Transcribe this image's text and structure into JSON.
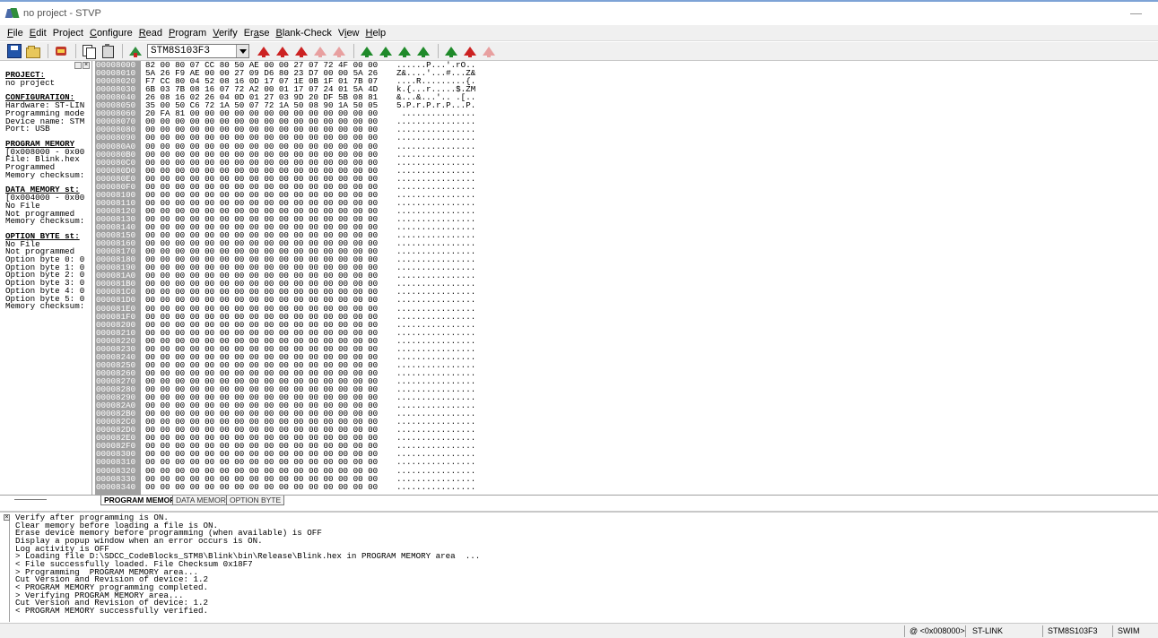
{
  "window": {
    "title": "no project - STVP",
    "min_glyph": "—"
  },
  "menu": [
    {
      "label": "File",
      "ul": "F",
      "rest": "ile"
    },
    {
      "label": "Edit",
      "ul": "E",
      "rest": "dit"
    },
    {
      "label": "Project",
      "ul": "j",
      "pre": "Pro",
      "rest": "ect"
    },
    {
      "label": "Configure",
      "ul": "C",
      "rest": "onfigure"
    },
    {
      "label": "Read",
      "ul": "R",
      "rest": "ead"
    },
    {
      "label": "Program",
      "ul": "P",
      "rest": "rogram"
    },
    {
      "label": "Verify",
      "ul": "V",
      "rest": "erify"
    },
    {
      "label": "Erase",
      "ul": "a",
      "pre": "Er",
      "rest": "se"
    },
    {
      "label": "Blank-Check",
      "ul": "B",
      "rest": "lank-Check"
    },
    {
      "label": "View",
      "ul": "i",
      "pre": "V",
      "rest": "ew"
    },
    {
      "label": "Help",
      "ul": "H",
      "rest": "elp"
    }
  ],
  "toolbar": {
    "device": "STM8S103F3",
    "arrow_colors": [
      "#cc2222",
      "#cc2222",
      "#cc2222",
      "#e8a0a0",
      "#e8a0a0",
      "#1f8a2a",
      "#1f8a2a",
      "#1f8a2a",
      "#1f8a2a",
      "#1f8a2a",
      "#cc2222",
      "#e8a0a0"
    ]
  },
  "info_panel": {
    "project_header": "PROJECT:",
    "project_lines": [
      "no project"
    ],
    "config_header": "CONFIGURATION:",
    "config_lines": [
      "Hardware: ST-LIN",
      "Programming mode",
      "Device name: STM",
      "Port: USB"
    ],
    "prog_header": "PROGRAM MEMORY",
    "prog_lines": [
      "[0x008000 - 0x00",
      "File: Blink.hex",
      "Programmed",
      "Memory checksum:"
    ],
    "data_header": "DATA MEMORY st:",
    "data_lines": [
      "[0x004000 - 0x00",
      "No File",
      "Not programmed",
      "Memory checksum:"
    ],
    "opt_header": "OPTION BYTE st:",
    "opt_lines": [
      "No File",
      "Not programmed",
      "Option byte 0: 0",
      "Option byte 1: 0",
      "Option byte 2: 0",
      "Option byte 3: 0",
      "Option byte 4: 0",
      "Option byte 5: 0",
      "Memory checksum:"
    ]
  },
  "hex": {
    "rows": [
      {
        "addr": "00008000",
        "bytes": "82 00 80 07 CC 80 50 AE 00 00 27 07 72 4F 00 00",
        "ascii": "......P...'.rO.."
      },
      {
        "addr": "00008010",
        "bytes": "5A 26 F9 AE 00 00 27 09 D6 80 23 D7 00 00 5A 26",
        "ascii": "Z&....'...#...Z&"
      },
      {
        "addr": "00008020",
        "bytes": "F7 CC 80 04 52 08 16 0D 17 07 1E 0B 1F 01 7B 07",
        "ascii": "....R.........{."
      },
      {
        "addr": "00008030",
        "bytes": "6B 03 7B 08 16 07 72 A2 00 01 17 07 24 01 5A 4D",
        "ascii": "k.{...r.....$.ZM"
      },
      {
        "addr": "00008040",
        "bytes": "26 08 16 02 26 04 0D 01 27 03 9D 20 DF 5B 08 81",
        "ascii": "&...&...'.. .[.."
      },
      {
        "addr": "00008050",
        "bytes": "35 00 50 C6 72 1A 50 07 72 1A 50 08 90 1A 50 05",
        "ascii": "5.P.r.P.r.P...P."
      },
      {
        "addr": "00008060",
        "bytes": "20 FA 81 00 00 00 00 00 00 00 00 00 00 00 00 00",
        "ascii": " ..............."
      },
      {
        "addr": "00008070",
        "bytes": "00 00 00 00 00 00 00 00 00 00 00 00 00 00 00 00",
        "ascii": "................"
      },
      {
        "addr": "00008080",
        "bytes": "00 00 00 00 00 00 00 00 00 00 00 00 00 00 00 00",
        "ascii": "................"
      },
      {
        "addr": "00008090",
        "bytes": "00 00 00 00 00 00 00 00 00 00 00 00 00 00 00 00",
        "ascii": "................"
      },
      {
        "addr": "000080A0",
        "bytes": "00 00 00 00 00 00 00 00 00 00 00 00 00 00 00 00",
        "ascii": "................"
      },
      {
        "addr": "000080B0",
        "bytes": "00 00 00 00 00 00 00 00 00 00 00 00 00 00 00 00",
        "ascii": "................"
      },
      {
        "addr": "000080C0",
        "bytes": "00 00 00 00 00 00 00 00 00 00 00 00 00 00 00 00",
        "ascii": "................"
      },
      {
        "addr": "000080D0",
        "bytes": "00 00 00 00 00 00 00 00 00 00 00 00 00 00 00 00",
        "ascii": "................"
      },
      {
        "addr": "000080E0",
        "bytes": "00 00 00 00 00 00 00 00 00 00 00 00 00 00 00 00",
        "ascii": "................"
      },
      {
        "addr": "000080F0",
        "bytes": "00 00 00 00 00 00 00 00 00 00 00 00 00 00 00 00",
        "ascii": "................"
      },
      {
        "addr": "00008100",
        "bytes": "00 00 00 00 00 00 00 00 00 00 00 00 00 00 00 00",
        "ascii": "................"
      },
      {
        "addr": "00008110",
        "bytes": "00 00 00 00 00 00 00 00 00 00 00 00 00 00 00 00",
        "ascii": "................"
      },
      {
        "addr": "00008120",
        "bytes": "00 00 00 00 00 00 00 00 00 00 00 00 00 00 00 00",
        "ascii": "................"
      },
      {
        "addr": "00008130",
        "bytes": "00 00 00 00 00 00 00 00 00 00 00 00 00 00 00 00",
        "ascii": "................"
      },
      {
        "addr": "00008140",
        "bytes": "00 00 00 00 00 00 00 00 00 00 00 00 00 00 00 00",
        "ascii": "................"
      },
      {
        "addr": "00008150",
        "bytes": "00 00 00 00 00 00 00 00 00 00 00 00 00 00 00 00",
        "ascii": "................"
      },
      {
        "addr": "00008160",
        "bytes": "00 00 00 00 00 00 00 00 00 00 00 00 00 00 00 00",
        "ascii": "................"
      },
      {
        "addr": "00008170",
        "bytes": "00 00 00 00 00 00 00 00 00 00 00 00 00 00 00 00",
        "ascii": "................"
      },
      {
        "addr": "00008180",
        "bytes": "00 00 00 00 00 00 00 00 00 00 00 00 00 00 00 00",
        "ascii": "................"
      },
      {
        "addr": "00008190",
        "bytes": "00 00 00 00 00 00 00 00 00 00 00 00 00 00 00 00",
        "ascii": "................"
      },
      {
        "addr": "000081A0",
        "bytes": "00 00 00 00 00 00 00 00 00 00 00 00 00 00 00 00",
        "ascii": "................"
      },
      {
        "addr": "000081B0",
        "bytes": "00 00 00 00 00 00 00 00 00 00 00 00 00 00 00 00",
        "ascii": "................"
      },
      {
        "addr": "000081C0",
        "bytes": "00 00 00 00 00 00 00 00 00 00 00 00 00 00 00 00",
        "ascii": "................"
      },
      {
        "addr": "000081D0",
        "bytes": "00 00 00 00 00 00 00 00 00 00 00 00 00 00 00 00",
        "ascii": "................"
      },
      {
        "addr": "000081E0",
        "bytes": "00 00 00 00 00 00 00 00 00 00 00 00 00 00 00 00",
        "ascii": "................"
      },
      {
        "addr": "000081F0",
        "bytes": "00 00 00 00 00 00 00 00 00 00 00 00 00 00 00 00",
        "ascii": "................"
      },
      {
        "addr": "00008200",
        "bytes": "00 00 00 00 00 00 00 00 00 00 00 00 00 00 00 00",
        "ascii": "................"
      },
      {
        "addr": "00008210",
        "bytes": "00 00 00 00 00 00 00 00 00 00 00 00 00 00 00 00",
        "ascii": "................"
      },
      {
        "addr": "00008220",
        "bytes": "00 00 00 00 00 00 00 00 00 00 00 00 00 00 00 00",
        "ascii": "................"
      },
      {
        "addr": "00008230",
        "bytes": "00 00 00 00 00 00 00 00 00 00 00 00 00 00 00 00",
        "ascii": "................"
      },
      {
        "addr": "00008240",
        "bytes": "00 00 00 00 00 00 00 00 00 00 00 00 00 00 00 00",
        "ascii": "................"
      },
      {
        "addr": "00008250",
        "bytes": "00 00 00 00 00 00 00 00 00 00 00 00 00 00 00 00",
        "ascii": "................"
      },
      {
        "addr": "00008260",
        "bytes": "00 00 00 00 00 00 00 00 00 00 00 00 00 00 00 00",
        "ascii": "................"
      },
      {
        "addr": "00008270",
        "bytes": "00 00 00 00 00 00 00 00 00 00 00 00 00 00 00 00",
        "ascii": "................"
      },
      {
        "addr": "00008280",
        "bytes": "00 00 00 00 00 00 00 00 00 00 00 00 00 00 00 00",
        "ascii": "................"
      },
      {
        "addr": "00008290",
        "bytes": "00 00 00 00 00 00 00 00 00 00 00 00 00 00 00 00",
        "ascii": "................"
      },
      {
        "addr": "000082A0",
        "bytes": "00 00 00 00 00 00 00 00 00 00 00 00 00 00 00 00",
        "ascii": "................"
      },
      {
        "addr": "000082B0",
        "bytes": "00 00 00 00 00 00 00 00 00 00 00 00 00 00 00 00",
        "ascii": "................"
      },
      {
        "addr": "000082C0",
        "bytes": "00 00 00 00 00 00 00 00 00 00 00 00 00 00 00 00",
        "ascii": "................"
      },
      {
        "addr": "000082D0",
        "bytes": "00 00 00 00 00 00 00 00 00 00 00 00 00 00 00 00",
        "ascii": "................"
      },
      {
        "addr": "000082E0",
        "bytes": "00 00 00 00 00 00 00 00 00 00 00 00 00 00 00 00",
        "ascii": "................"
      },
      {
        "addr": "000082F0",
        "bytes": "00 00 00 00 00 00 00 00 00 00 00 00 00 00 00 00",
        "ascii": "................"
      },
      {
        "addr": "00008300",
        "bytes": "00 00 00 00 00 00 00 00 00 00 00 00 00 00 00 00",
        "ascii": "................"
      },
      {
        "addr": "00008310",
        "bytes": "00 00 00 00 00 00 00 00 00 00 00 00 00 00 00 00",
        "ascii": "................"
      },
      {
        "addr": "00008320",
        "bytes": "00 00 00 00 00 00 00 00 00 00 00 00 00 00 00 00",
        "ascii": "................"
      },
      {
        "addr": "00008330",
        "bytes": "00 00 00 00 00 00 00 00 00 00 00 00 00 00 00 00",
        "ascii": "................"
      },
      {
        "addr": "00008340",
        "bytes": "00 00 00 00 00 00 00 00 00 00 00 00 00 00 00 00",
        "ascii": "................"
      }
    ]
  },
  "tabs": [
    "PROGRAM MEMORY",
    "DATA MEMORY",
    "OPTION BYTE"
  ],
  "log": [
    "Verify after programming is ON.",
    "Clear memory before loading a file is ON.",
    "Erase device memory before programming (when available) is OFF",
    "Display a popup window when an error occurs is ON.",
    "Log activity is OFF",
    "> Loading file D:\\SDCC_CodeBlocks_STM8\\Blink\\bin\\Release\\Blink.hex in PROGRAM MEMORY area  ...",
    "< File successfully loaded. File Checksum 0x18F7",
    "> Programming  PROGRAM MEMORY area...",
    "Cut Version and Revision of device: 1.2",
    "< PROGRAM MEMORY programming completed.",
    "> Verifying PROGRAM MEMORY area...",
    "Cut Version and Revision of device: 1.2",
    "< PROGRAM MEMORY successfully verified."
  ],
  "status": {
    "address": "@ <0x008000>",
    "programmer": "ST-LINK",
    "device": "STM8S103F3",
    "protocol": "SWIM"
  }
}
